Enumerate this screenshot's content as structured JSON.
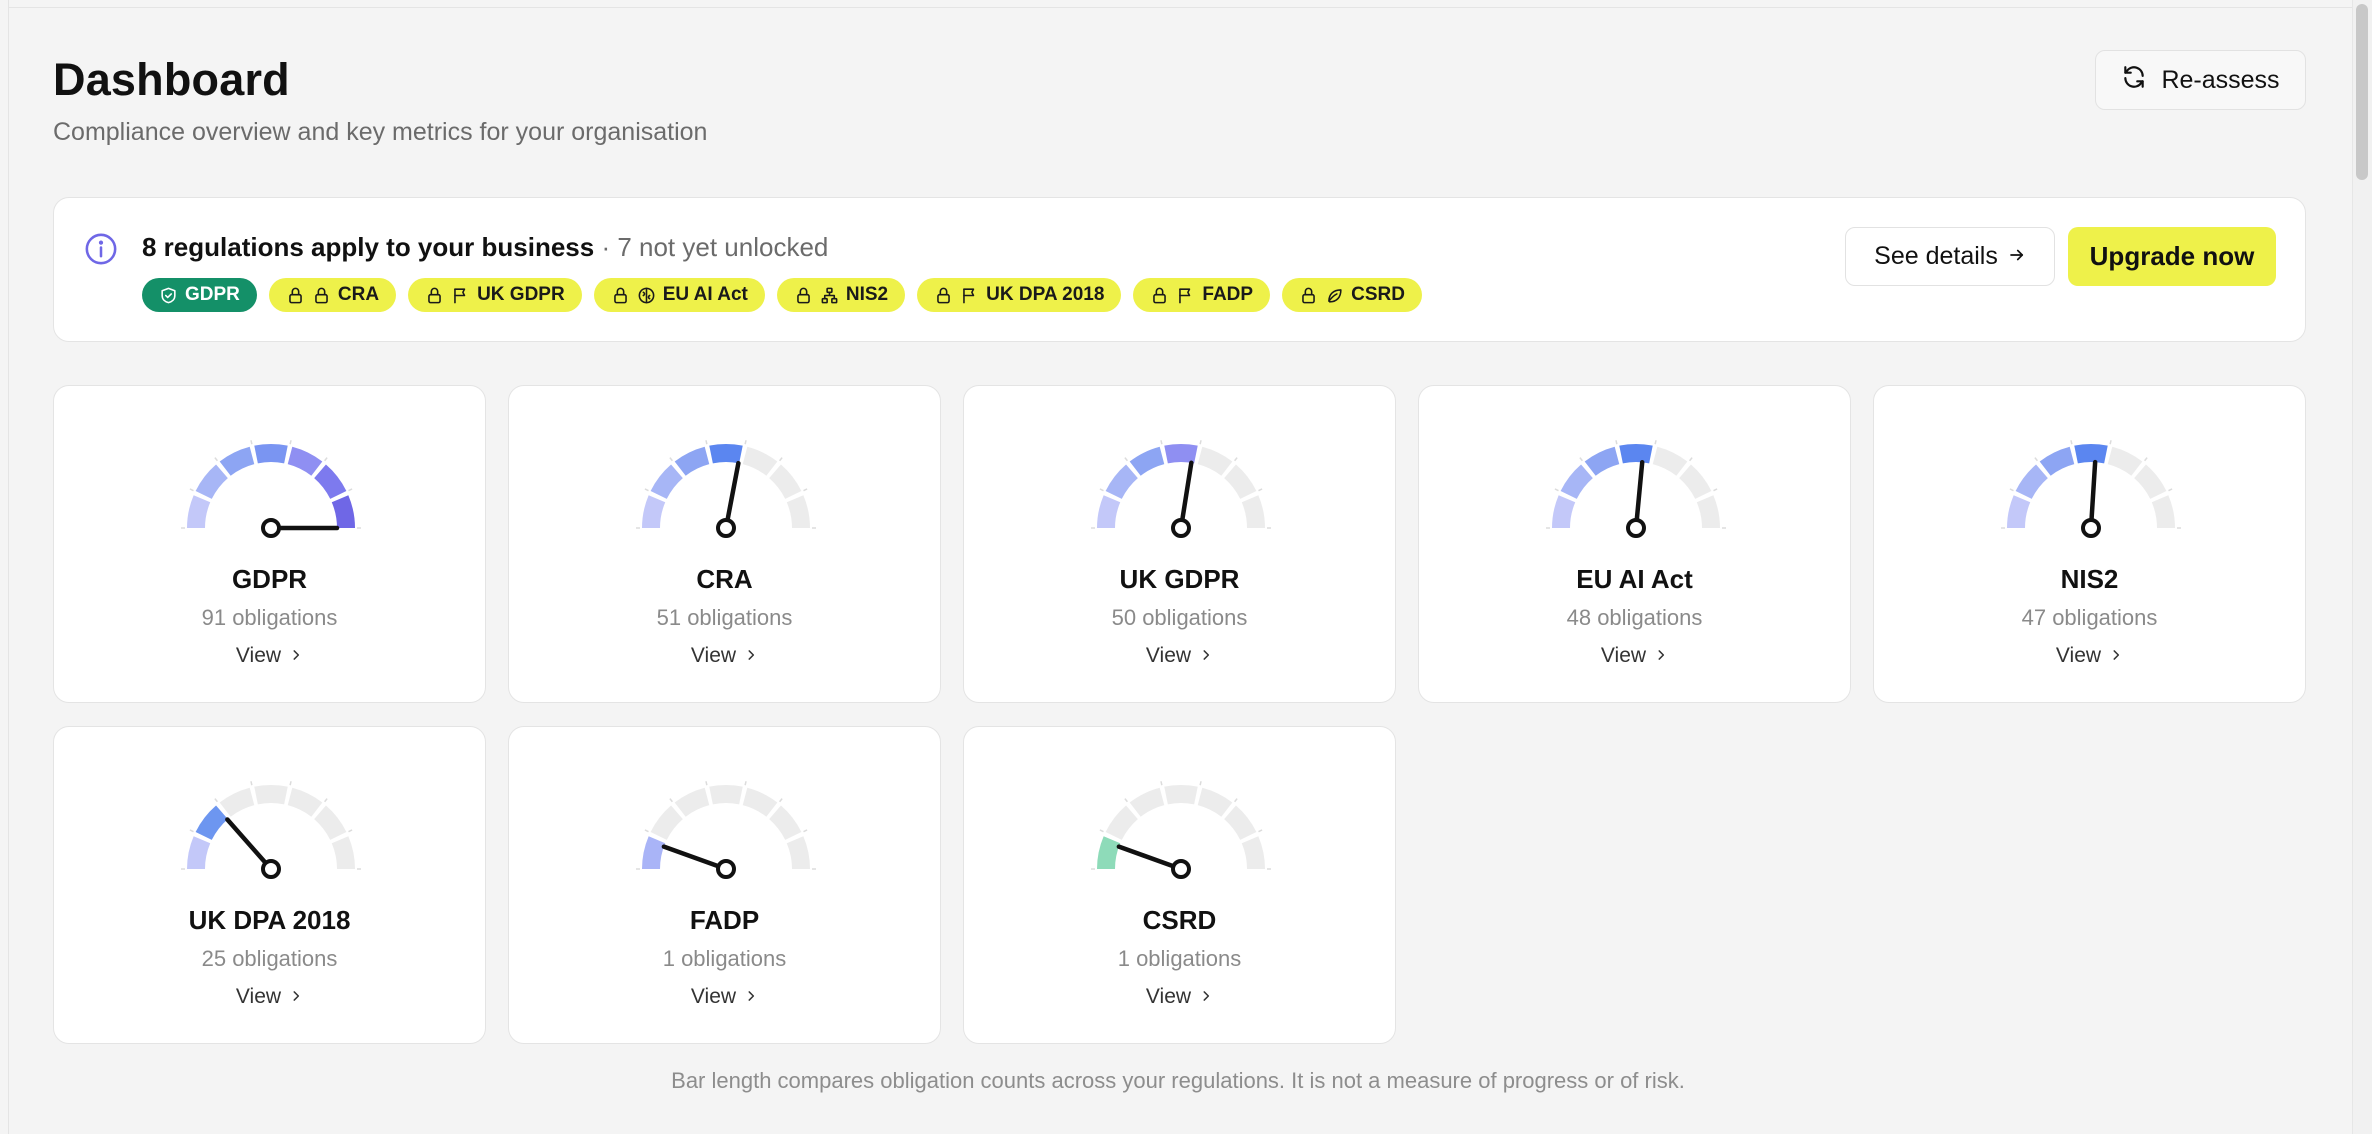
{
  "header": {
    "title": "Dashboard",
    "subtitle": "Compliance overview and key metrics for your organisation",
    "reassess_label": "Re-assess"
  },
  "banner": {
    "headline": "8 regulations apply to your business",
    "separator": " · ",
    "detail": "7 not yet unlocked",
    "see_details_label": "See details",
    "upgrade_label": "Upgrade now",
    "chips": [
      {
        "label": "GDPR",
        "locked": false,
        "icon": "shield-check-icon"
      },
      {
        "label": "CRA",
        "locked": true,
        "icon": "lock-icon"
      },
      {
        "label": "UK GDPR",
        "locked": true,
        "icon": "flag-icon"
      },
      {
        "label": "EU AI Act",
        "locked": true,
        "icon": "brain-icon"
      },
      {
        "label": "NIS2",
        "locked": true,
        "icon": "network-icon"
      },
      {
        "label": "UK DPA 2018",
        "locked": true,
        "icon": "flag-icon"
      },
      {
        "label": "FADP",
        "locked": true,
        "icon": "flag-icon"
      },
      {
        "label": "CSRD",
        "locked": true,
        "icon": "leaf-icon"
      }
    ]
  },
  "cards": [
    {
      "name": "GDPR",
      "count": "91 obligations",
      "view_label": "View",
      "fill_fraction": 1.0,
      "accent": "#6f67e6"
    },
    {
      "name": "CRA",
      "count": "51 obligations",
      "view_label": "View",
      "fill_fraction": 0.56,
      "accent": "#5b86f0"
    },
    {
      "name": "UK GDPR",
      "count": "50 obligations",
      "view_label": "View",
      "fill_fraction": 0.55,
      "accent": "#8f8ff2"
    },
    {
      "name": "EU AI Act",
      "count": "48 obligations",
      "view_label": "View",
      "fill_fraction": 0.53,
      "accent": "#5b86f0"
    },
    {
      "name": "NIS2",
      "count": "47 obligations",
      "view_label": "View",
      "fill_fraction": 0.52,
      "accent": "#5b86f0"
    },
    {
      "name": "UK DPA 2018",
      "count": "25 obligations",
      "view_label": "View",
      "fill_fraction": 0.27,
      "accent": "#6d96f0"
    },
    {
      "name": "FADP",
      "count": "1 obligations",
      "view_label": "View",
      "fill_fraction": 0.11,
      "accent": "#a9b4f7"
    },
    {
      "name": "CSRD",
      "count": "1 obligations",
      "view_label": "View",
      "fill_fraction": 0.11,
      "accent": "#8edbb9"
    }
  ],
  "footnote": "Bar length compares obligation counts across your regulations. It is not a measure of progress or of risk.",
  "colors": {
    "chip_locked": "#eef14a",
    "chip_active": "#149068",
    "upgrade": "#eef14a",
    "segment_palette": [
      "#c3c8f9",
      "#a7b6f6",
      "#8da5f3",
      "#7a95f2",
      "#8f8ff2",
      "#7d7aee",
      "#6f67e6"
    ],
    "segment_empty": "#ececec"
  }
}
